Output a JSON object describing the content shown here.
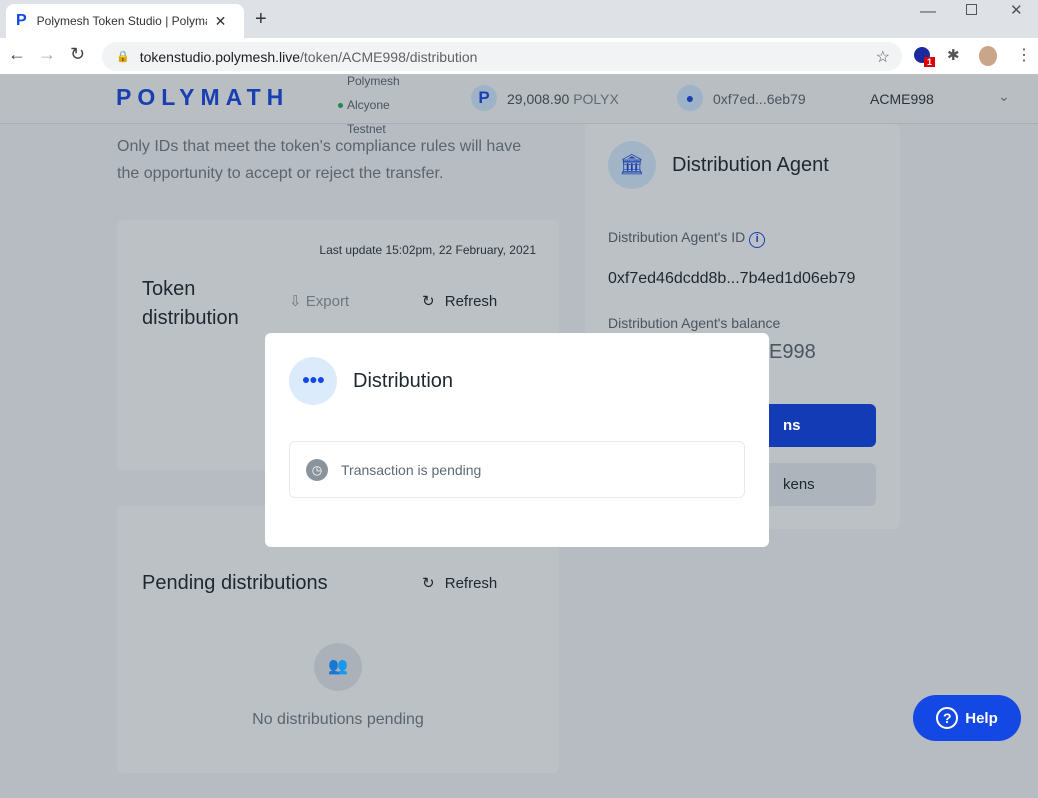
{
  "browser": {
    "tab_title": "Polymesh Token Studio | Polymath",
    "url_host": "tokenstudio.polymesh.live",
    "url_path": "/token/ACME998/distribution",
    "ext_badge": "1"
  },
  "header": {
    "logo": "POLYMATH",
    "network": [
      "Polymesh",
      "Alcyone",
      "Testnet"
    ],
    "balance": "29,008.90",
    "balance_unit": "POLYX",
    "account": "0xf7ed...6eb79",
    "token": "ACME998"
  },
  "intro": {
    "line1": "Only IDs that meet the token's compliance rules will have",
    "line2": "the opportunity to accept or reject the transfer."
  },
  "token_distribution": {
    "last_update": "Last update 15:02pm, 22 February, 2021",
    "title1": "Token",
    "title2": "distribution",
    "export": "Export",
    "refresh": "Refresh"
  },
  "pending": {
    "title": "Pending distributions",
    "refresh": "Refresh",
    "empty": "No distributions pending"
  },
  "agent": {
    "title": "Distribution Agent",
    "id_label": "Distribution Agent's ID",
    "id_value": "0xf7ed46dcdd8b...7b4ed1d06eb79",
    "balance_label": "Distribution Agent's balance",
    "balance_fragment": "E998",
    "primary_fragment": "ns",
    "secondary_fragment": "kens"
  },
  "modal": {
    "title": "Distribution",
    "status": "Transaction is pending"
  },
  "help": {
    "label": "Help"
  },
  "colors": {
    "brand": "#1348e5",
    "overlay_bg": "#b6bcc2"
  }
}
